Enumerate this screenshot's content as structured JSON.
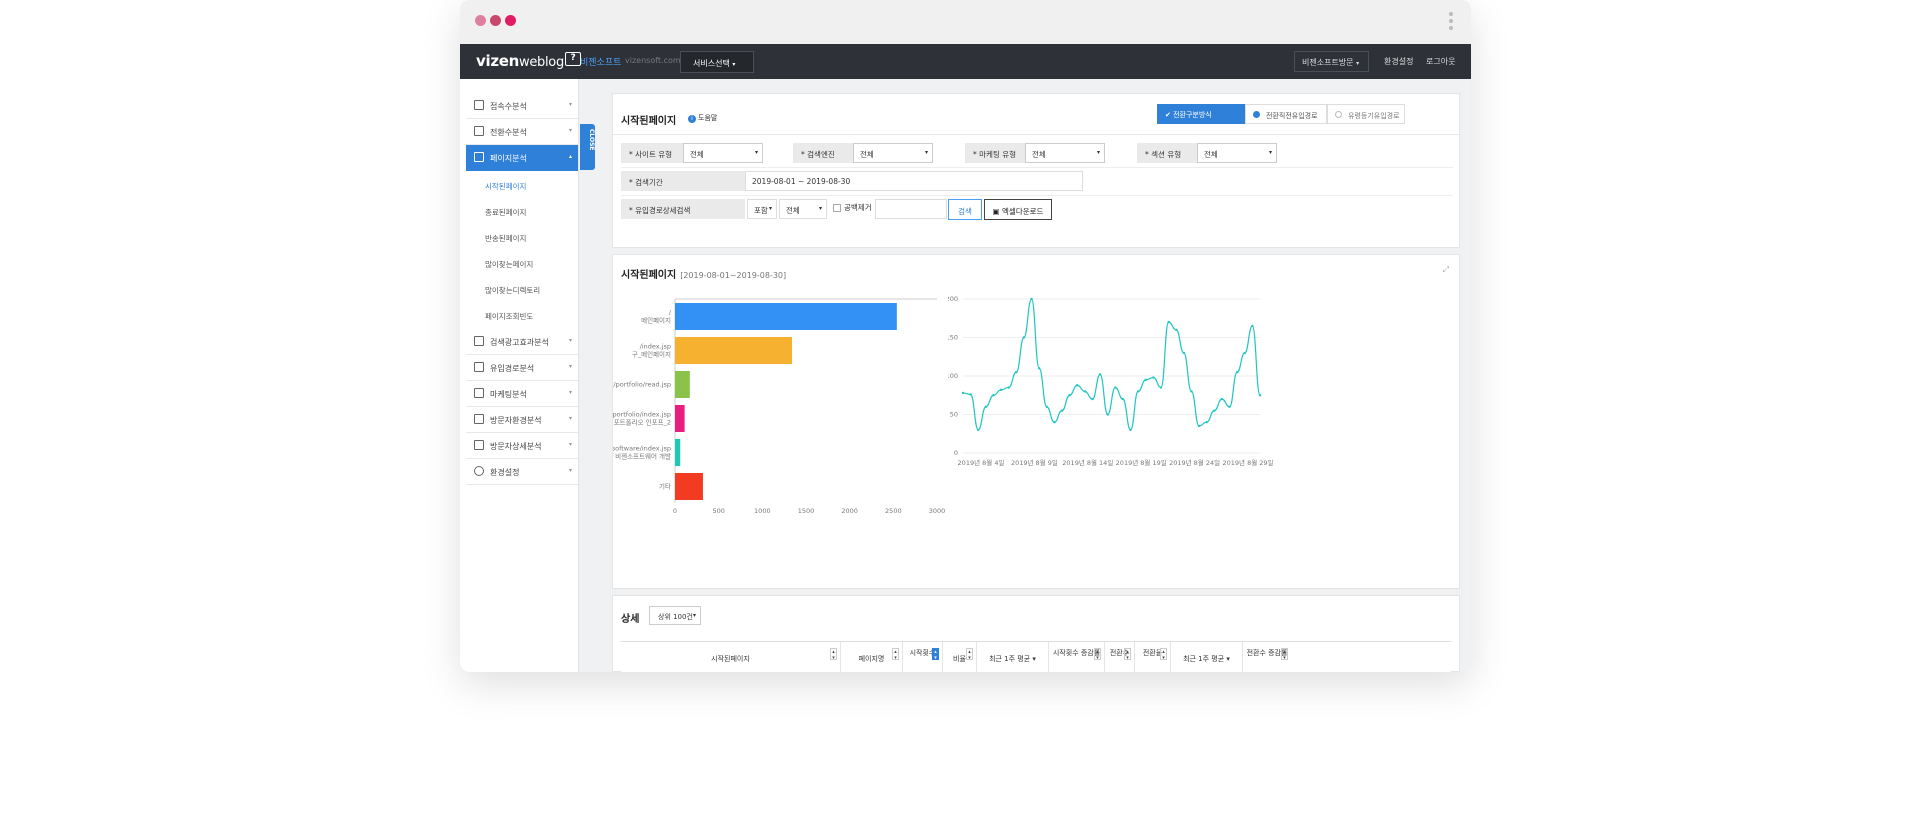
{
  "colors": {
    "accent": "#2f80d8",
    "dot1": "#dd7f9e",
    "dot2": "#c9466f",
    "dot3": "#e01c62",
    "topnav": "#2e3238",
    "line": "#1fc6c0"
  },
  "nav": {
    "logo_main": "vizen",
    "logo_sub": "weblog",
    "logo_icon": "?",
    "brand": "비젠소프트",
    "site": "vizensoft.com",
    "service": "서비스선택",
    "links": [
      "비젠소프트방문",
      "환경설정",
      "로그아웃"
    ]
  },
  "sidebar": {
    "items": [
      {
        "label": "접속수분석",
        "icon": "doc-chart-icon"
      },
      {
        "label": "전환수분석",
        "icon": "doc-chart-icon"
      },
      {
        "label": "페이지분석",
        "icon": "doc-icon"
      },
      {
        "label": "검색광고효과분석",
        "icon": "search-ad-icon"
      },
      {
        "label": "유입경로분석",
        "icon": "monitor-icon"
      },
      {
        "label": "마케팅분석",
        "icon": "megaphone-icon"
      },
      {
        "label": "방문자환경분석",
        "icon": "network-icon"
      },
      {
        "label": "방문자상세분석",
        "icon": "person-icon"
      },
      {
        "label": "환경설정",
        "icon": "gear-icon"
      }
    ],
    "subitems": [
      "시작된페이지",
      "종료된페이지",
      "반송된페이지",
      "많이찾는페이지",
      "많이찾는디렉토리",
      "페이지조회빈도"
    ],
    "close_tab": "CLOSE"
  },
  "filter": {
    "title": "시작된페이지",
    "help": "도움말",
    "segments": [
      "전환구분방식",
      "전환직전유입경로",
      "유령등기유입경로"
    ],
    "fields": [
      {
        "label": "사이트 유형",
        "value": "전체"
      },
      {
        "label": "검색엔진",
        "value": "전체"
      },
      {
        "label": "마케팅 유형",
        "value": "전체"
      },
      {
        "label": "섹션 유형",
        "value": "전체"
      }
    ],
    "period_label": "검색기간",
    "period_value": "2019-08-01 ~ 2019-08-30",
    "path_label": "유입경로상세검색",
    "path_mode": "포함",
    "path_scope": "전체",
    "remove_space": "공백제거",
    "search_button": "검색",
    "excel_button": "엑셀다운로드"
  },
  "chart_panel": {
    "title": "시작된페이지",
    "range": "[2019-08-01~2019-08-30]"
  },
  "chart_data": [
    {
      "type": "bar",
      "orientation": "horizontal",
      "categories": [
        [
          "/",
          "메인페이지"
        ],
        [
          "/index.jsp",
          "구_메인페이지"
        ],
        [
          "/portfolio/read.jsp"
        ],
        [
          "/portfolio/index.jsp",
          "포트폴리오 인포프_2"
        ],
        [
          "/software/index.jsp",
          "비젠소프트웨어 개발"
        ],
        [
          "기타"
        ]
      ],
      "values": [
        2540,
        1340,
        170,
        110,
        60,
        320
      ],
      "colors": [
        "#3391f5",
        "#f5b12f",
        "#8bc34a",
        "#e91e7f",
        "#20c8b8",
        "#f33b22"
      ],
      "xlim": [
        0,
        3000
      ],
      "xticks": [
        0,
        500,
        1000,
        1500,
        2000,
        2500,
        3000
      ]
    },
    {
      "type": "line",
      "x": [
        1,
        2,
        3,
        4,
        5,
        6,
        7,
        8,
        9,
        10,
        11,
        12,
        13,
        14,
        15,
        16,
        17,
        18,
        19,
        20,
        21,
        22,
        23,
        24,
        25,
        26,
        27,
        28,
        29,
        30
      ],
      "values": [
        78,
        76,
        30,
        60,
        75,
        82,
        85,
        105,
        150,
        200,
        110,
        60,
        40,
        55,
        75,
        88,
        80,
        70,
        102,
        50,
        85,
        70,
        30,
        80,
        95,
        98,
        85,
        170,
        160,
        130,
        80,
        35,
        40,
        55,
        70,
        60,
        105,
        130,
        165,
        75
      ],
      "ylim": [
        0,
        200
      ],
      "yticks": [
        0,
        50,
        100,
        150,
        200
      ],
      "xtick_labels": [
        "2019년 8월 4일",
        "2019년 8월 9일",
        "2019년 8월 14일",
        "2019년 8월 19일",
        "2019년 8월 24일",
        "2019년 8월 29일"
      ]
    }
  ],
  "detail": {
    "title": "상세",
    "top_n": "상위 100건",
    "columns": [
      "시작된페이지",
      "페이지명",
      "시작횟수",
      "비율",
      "최근 1주 평균",
      "시작횟수 증감률",
      "전환수",
      "전환율",
      "최근 1주 평균",
      "전환수 증감률"
    ]
  }
}
